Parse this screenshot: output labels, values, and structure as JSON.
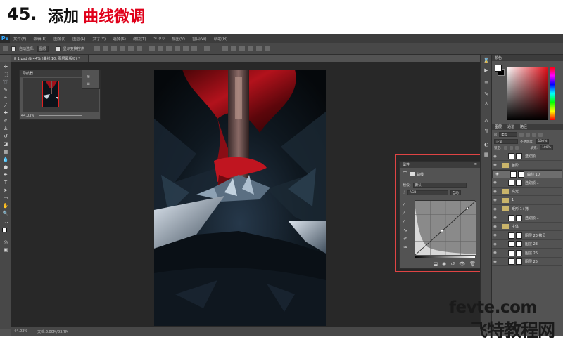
{
  "header": {
    "number": "45.",
    "text_main": "添加",
    "text_accent": "曲线微调",
    "accent_color": "#e0001a"
  },
  "app": {
    "logo": "Ps",
    "menu": [
      "文件(F)",
      "编辑(E)",
      "图像(I)",
      "图层(L)",
      "文字(Y)",
      "选择(S)",
      "滤镜(T)",
      "3D(D)",
      "视图(V)",
      "窗口(W)",
      "帮助(H)"
    ],
    "options": {
      "auto_select_label": "自动选择:",
      "auto_select_value": "图层",
      "show_transform_label": "显示变换控件"
    },
    "doc_tab": "8 1.psd @ 44% (曲线 10, 图层蒙版/8) *",
    "status": {
      "zoom": "44.03%",
      "doc_size": "文档:8.00M/83.7M"
    }
  },
  "navigator": {
    "title": "导航器",
    "zoom": "44.03%"
  },
  "properties": {
    "title": "属性",
    "type_label": "曲线",
    "preset_label": "预设:",
    "preset_value": "默认",
    "channel_value": "RGB",
    "auto_button": "自动"
  },
  "layers": {
    "tabs": [
      "图层",
      "通道",
      "路径"
    ],
    "filter_value": "类型",
    "blend_value": "正常",
    "opacity_label": "不透明度:",
    "opacity_value": "100%",
    "lock_label": "锁定:",
    "fill_label": "填充:",
    "fill_value": "100%",
    "rows": [
      {
        "name": "选取颜...",
        "thumb": "white",
        "sel": false
      },
      {
        "name": "色阶 1...",
        "thumb": "folder",
        "sel": false
      },
      {
        "name": "曲线 10",
        "thumb": "white",
        "sel": true
      },
      {
        "name": "选取颜...",
        "thumb": "white",
        "sel": false
      },
      {
        "name": "高光",
        "thumb": "folder",
        "sel": false
      },
      {
        "name": "1",
        "thumb": "folder",
        "sel": false
      },
      {
        "name": "矩形 1+拷",
        "thumb": "folder",
        "sel": false
      },
      {
        "name": "选取颜...",
        "thumb": "white",
        "sel": false
      },
      {
        "name": "主体",
        "thumb": "folder",
        "sel": false
      },
      {
        "name": "图层 23 拷贝",
        "thumb": "white",
        "sel": false
      },
      {
        "name": "图层 23",
        "thumb": "white",
        "sel": false
      },
      {
        "name": "图层 26",
        "thumb": "white",
        "sel": false
      },
      {
        "name": "图层 25",
        "thumb": "white",
        "sel": false
      }
    ]
  },
  "watermark": {
    "line1": "fevte.com",
    "line2": "飞特教程网"
  }
}
